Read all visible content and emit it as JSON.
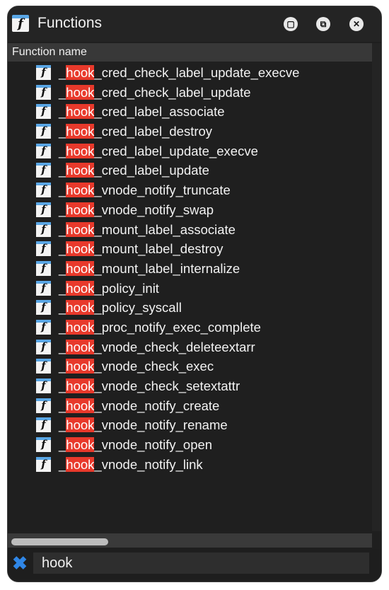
{
  "window": {
    "title": "Functions",
    "icon": "function-icon",
    "buttons": [
      "dock-button",
      "float-button",
      "close-button"
    ]
  },
  "table": {
    "column_header": "Function name",
    "rows": [
      {
        "prefix": "_",
        "match": "hook",
        "rest": "_cred_check_label_update_execve"
      },
      {
        "prefix": "_",
        "match": "hook",
        "rest": "_cred_check_label_update"
      },
      {
        "prefix": "_",
        "match": "hook",
        "rest": "_cred_label_associate"
      },
      {
        "prefix": "_",
        "match": "hook",
        "rest": "_cred_label_destroy"
      },
      {
        "prefix": "_",
        "match": "hook",
        "rest": "_cred_label_update_execve"
      },
      {
        "prefix": "_",
        "match": "hook",
        "rest": "_cred_label_update"
      },
      {
        "prefix": "_",
        "match": "hook",
        "rest": "_vnode_notify_truncate"
      },
      {
        "prefix": "_",
        "match": "hook",
        "rest": "_vnode_notify_swap"
      },
      {
        "prefix": "_",
        "match": "hook",
        "rest": "_mount_label_associate"
      },
      {
        "prefix": "_",
        "match": "hook",
        "rest": "_mount_label_destroy"
      },
      {
        "prefix": "_",
        "match": "hook",
        "rest": "_mount_label_internalize"
      },
      {
        "prefix": "_",
        "match": "hook",
        "rest": "_policy_init"
      },
      {
        "prefix": "_",
        "match": "hook",
        "rest": "_policy_syscall"
      },
      {
        "prefix": "_",
        "match": "hook",
        "rest": "_proc_notify_exec_complete"
      },
      {
        "prefix": "_",
        "match": "hook",
        "rest": "_vnode_check_deleteextarr"
      },
      {
        "prefix": "_",
        "match": "hook",
        "rest": "_vnode_check_exec"
      },
      {
        "prefix": "_",
        "match": "hook",
        "rest": "_vnode_check_setextattr"
      },
      {
        "prefix": "_",
        "match": "hook",
        "rest": "_vnode_notify_create"
      },
      {
        "prefix": "_",
        "match": "hook",
        "rest": "_vnode_notify_rename"
      },
      {
        "prefix": "_",
        "match": "hook",
        "rest": "_vnode_notify_open"
      },
      {
        "prefix": "_",
        "match": "hook",
        "rest": "_vnode_notify_link"
      }
    ]
  },
  "search": {
    "value": "hook",
    "clear_icon": "clear-icon"
  },
  "colors": {
    "highlight": "#e8392b",
    "background": "#1f1f1f",
    "icon_accent": "#5aa7e6"
  }
}
